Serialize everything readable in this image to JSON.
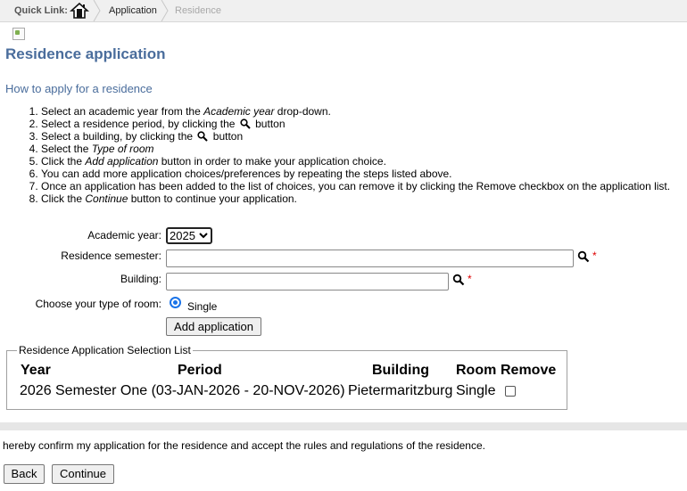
{
  "breadcrumb": {
    "quick_link_label": "Quick Link:",
    "items": [
      "Application",
      "Residence"
    ]
  },
  "page": {
    "title": "Residence application",
    "subtitle": "How to apply for a residence"
  },
  "steps": [
    {
      "pre": "Select an academic year from the ",
      "em": "Academic year",
      "post": " drop-down."
    },
    {
      "pre": "Select a residence period, by clicking the ",
      "icon": "magnifier-icon",
      "post": " button"
    },
    {
      "pre": "Select a building, by clicking the ",
      "icon": "magnifier-icon",
      "post": " button"
    },
    {
      "pre": "Select the ",
      "em": "Type of room",
      "post": ""
    },
    {
      "pre": "Click the ",
      "em": "Add application",
      "post": " button in order to make your application choice."
    },
    {
      "pre": "You can add more application choices/preferences by repeating the steps listed above.",
      "post": ""
    },
    {
      "pre": "Once an application has been added to the list of choices, you can remove it by clicking the Remove checkbox on the application list.",
      "post": ""
    },
    {
      "pre": "Click the ",
      "em": "Continue",
      "post": " button to continue your application."
    }
  ],
  "form": {
    "academic_year_label": "Academic year:",
    "academic_year_value": "2025",
    "residence_semester_label": "Residence semester:",
    "residence_semester_value": "",
    "building_label": "Building:",
    "building_value": "",
    "required_marker": "*",
    "room_type_label": "Choose your type of room:",
    "room_type_option": "Single",
    "add_button": "Add application"
  },
  "selection_list": {
    "legend": "Residence Application Selection List",
    "columns": [
      "Year",
      "Period",
      "Building",
      "Room",
      "Remove"
    ],
    "rows": [
      {
        "year": "2026",
        "period": "Semester One (03-JAN-2026 - 20-NOV-2026)",
        "building": "Pietermaritzburg",
        "room": "Single",
        "remove": false
      }
    ]
  },
  "confirmation_text": "hereby confirm my application for the residence and accept the rules and regulations of the residence.",
  "buttons": {
    "back": "Back",
    "continue": "Continue"
  },
  "colors": {
    "title": "#4a6d9c",
    "required": "#dd0000",
    "radio_accent": "#1a73e8"
  }
}
